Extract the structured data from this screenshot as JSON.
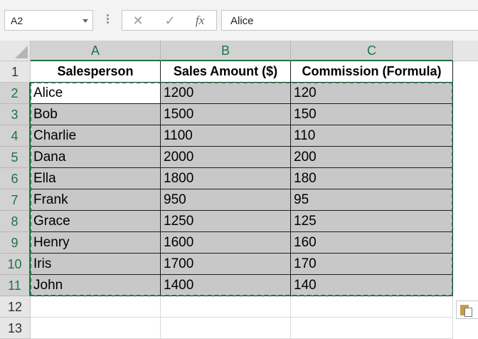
{
  "formula_bar": {
    "name_box": "A2",
    "cancel_icon": "✕",
    "enter_icon": "✓",
    "fx_label": "fx",
    "formula_value": "Alice"
  },
  "columns": [
    "A",
    "B",
    "C"
  ],
  "row_numbers": [
    "1",
    "2",
    "3",
    "4",
    "5",
    "6",
    "7",
    "8",
    "9",
    "10",
    "11",
    "12",
    "13"
  ],
  "headers": [
    "Salesperson",
    "Sales Amount ($)",
    "Commission (Formula)"
  ],
  "rows": [
    [
      "Alice",
      "1200",
      "120"
    ],
    [
      "Bob",
      "1500",
      "150"
    ],
    [
      "Charlie",
      "1100",
      "110"
    ],
    [
      "Dana",
      "2000",
      "200"
    ],
    [
      "Ella",
      "1800",
      "180"
    ],
    [
      "Frank",
      "950",
      "95"
    ],
    [
      "Grace",
      "1250",
      "125"
    ],
    [
      "Henry",
      "1600",
      "160"
    ],
    [
      "Iris",
      "1700",
      "170"
    ],
    [
      "John",
      "1400",
      "140"
    ]
  ],
  "icons": {
    "name_box_dropdown": "chevron-down-icon",
    "paste_options": "clipboard-icon"
  },
  "colors": {
    "accent": "#217346",
    "selection_fill": "#c8c8c8"
  }
}
